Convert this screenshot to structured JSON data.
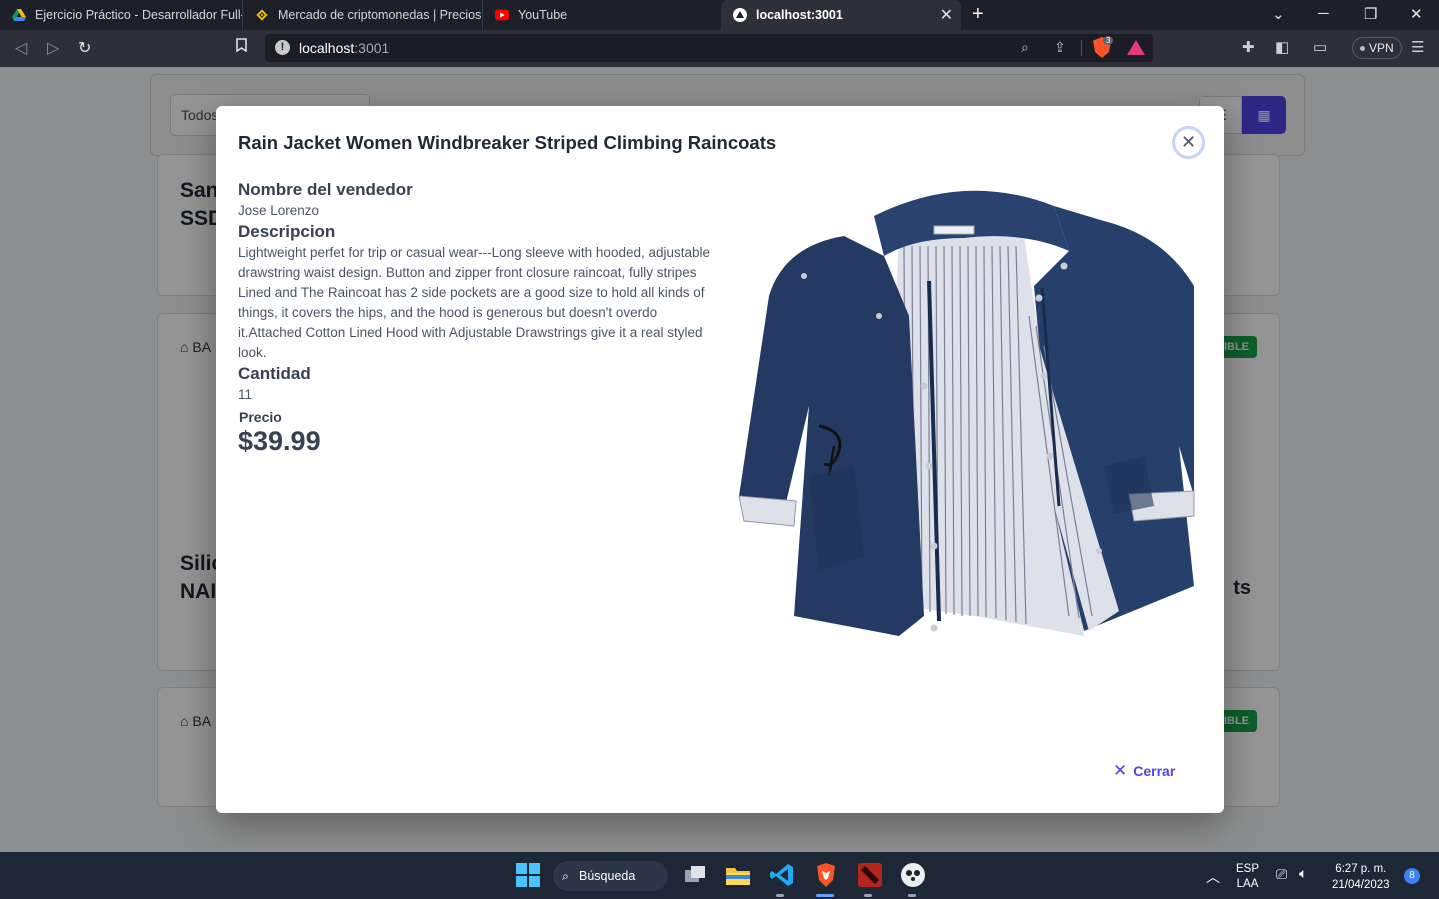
{
  "browser": {
    "tabs": [
      {
        "title": "Ejercicio Práctico - Desarrollador Full-s",
        "icon": "google-drive-icon"
      },
      {
        "title": "Mercado de criptomonedas | Precios y",
        "icon": "binance-icon"
      },
      {
        "title": "YouTube",
        "icon": "youtube-icon"
      },
      {
        "title": "localhost:3001",
        "icon": "nextjs-icon",
        "active": true
      }
    ],
    "url_host": "localhost",
    "url_port": ":3001",
    "shield_count": "3",
    "vpn_label": "VPN"
  },
  "background_page": {
    "filter_select_value": "Todos",
    "cards": [
      {
        "title_line1": "San",
        "title_line2": "SSD",
        "tag": "BA",
        "badge": ""
      },
      {
        "title_line1": "Silic",
        "title_line2": "NAI",
        "tag": "BA",
        "badge": "NIBLE",
        "right_text": "ts"
      },
      {
        "title_line1": "",
        "title_line2": "",
        "tag": "BA",
        "badge": "NIBLE"
      }
    ]
  },
  "modal": {
    "title": "Rain Jacket Women Windbreaker Striped Climbing Raincoats",
    "seller_label": "Nombre del vendedor",
    "seller_name": "Jose Lorenzo",
    "description_label": "Descripcion",
    "description": "Lightweight perfet for trip or casual wear---Long sleeve with hooded, adjustable drawstring waist design. Button and zipper front closure raincoat, fully stripes Lined and The Raincoat has 2 side pockets are a good size to hold all kinds of things, it covers the hips, and the hood is generous but doesn't overdo it.Attached Cotton Lined Hood with Adjustable Drawstrings give it a real styled look.",
    "quantity_label": "Cantidad",
    "quantity": "11",
    "price_label": "Precio",
    "price": "$39.99",
    "close_label": "Cerrar",
    "image": "navy-rain-jacket-product-image"
  },
  "taskbar": {
    "search_label": "Búsqueda",
    "language_line1": "ESP",
    "language_line2": "LAA",
    "time": "6:27 p. m.",
    "date": "21/04/2023",
    "notification_count": "8"
  },
  "colors": {
    "accent": "#4f46e5",
    "available_badge": "#16a34a",
    "jacket_navy": "#243a63"
  }
}
